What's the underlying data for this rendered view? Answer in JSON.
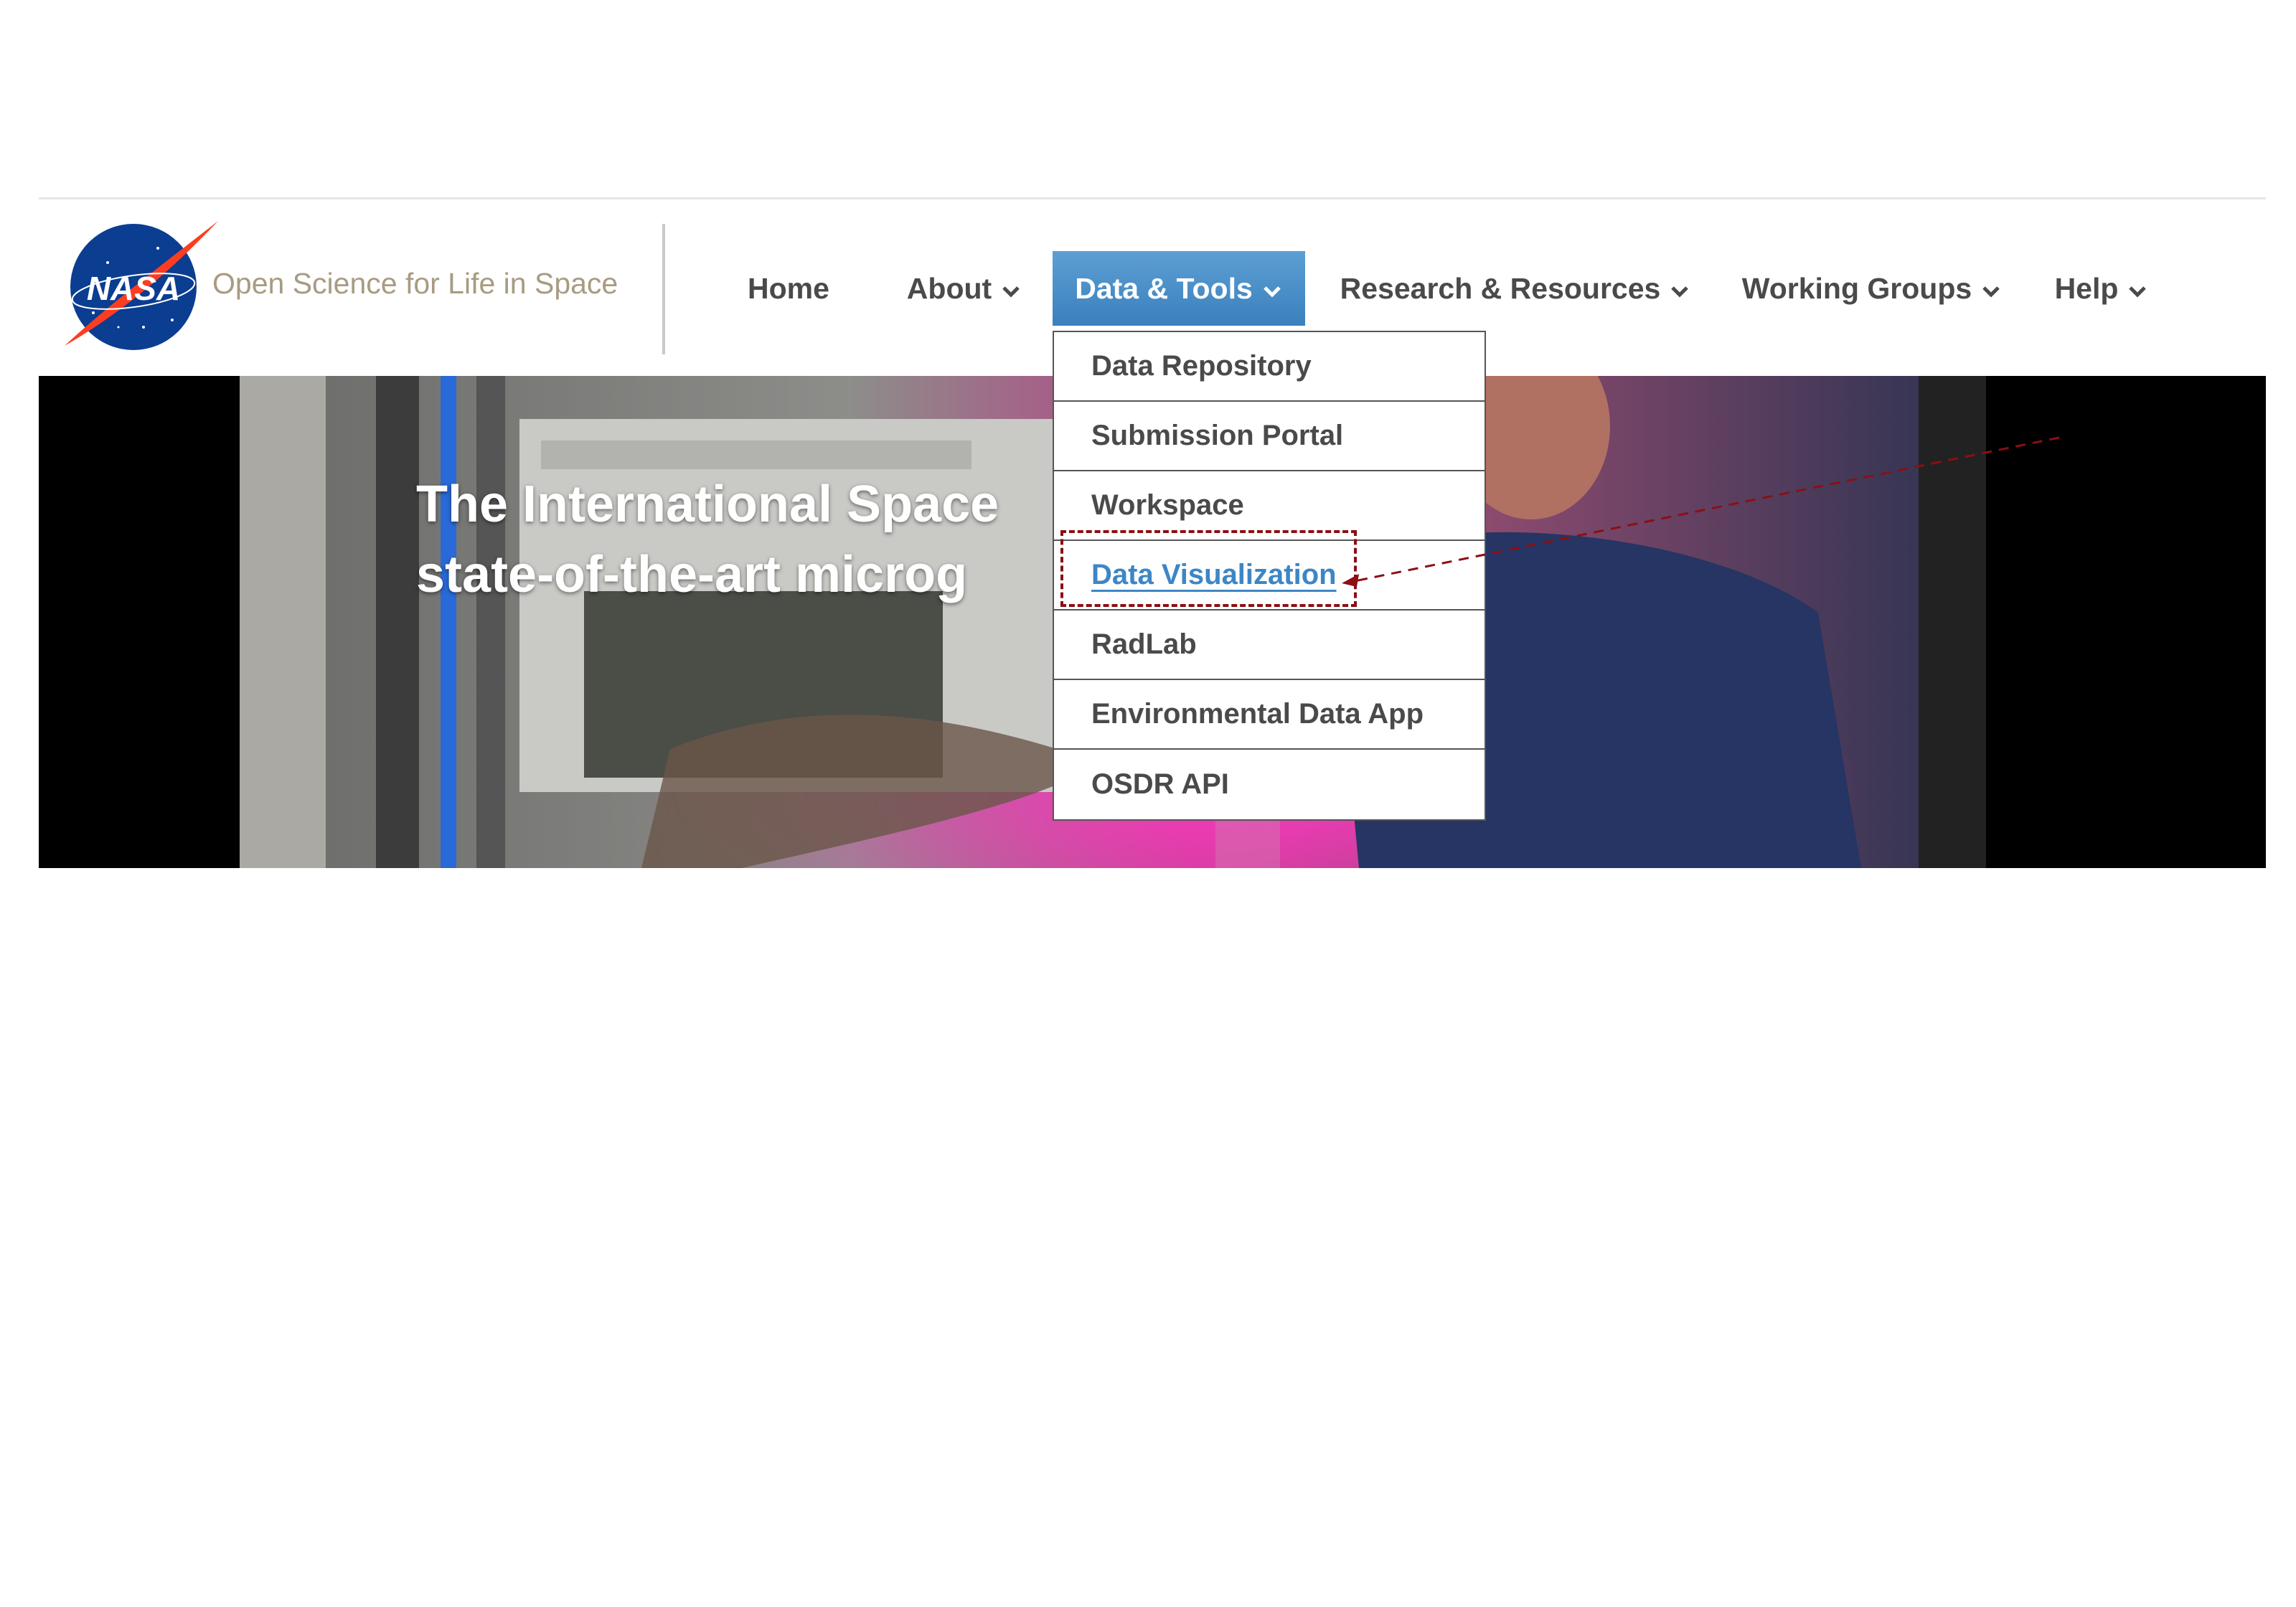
{
  "header": {
    "logo_text": "NASA",
    "site_title": "Open Science for Life in Space"
  },
  "nav": {
    "items": [
      {
        "label": "Home",
        "has_dropdown": false
      },
      {
        "label": "About",
        "has_dropdown": true
      },
      {
        "label": "Data & Tools",
        "has_dropdown": true,
        "active": true
      },
      {
        "label": "Research & Resources",
        "has_dropdown": true
      },
      {
        "label": "Working Groups",
        "has_dropdown": true
      },
      {
        "label": "Help",
        "has_dropdown": true
      }
    ]
  },
  "hero": {
    "line1": "The International Space",
    "line2": "state-of-the-art microg"
  },
  "dropdown": {
    "items": [
      {
        "label": "Data Repository"
      },
      {
        "label": "Submission Portal"
      },
      {
        "label": "Workspace"
      },
      {
        "label": "Data Visualization",
        "highlighted": true
      },
      {
        "label": "RadLab"
      },
      {
        "label": "Environmental Data App"
      },
      {
        "label": "OSDR API"
      }
    ]
  },
  "colors": {
    "nav_active_bg": "#4a8fcb",
    "link_blue": "#3d86c6",
    "annotation_red": "#8b0f14",
    "title_tan": "#a89b82"
  }
}
